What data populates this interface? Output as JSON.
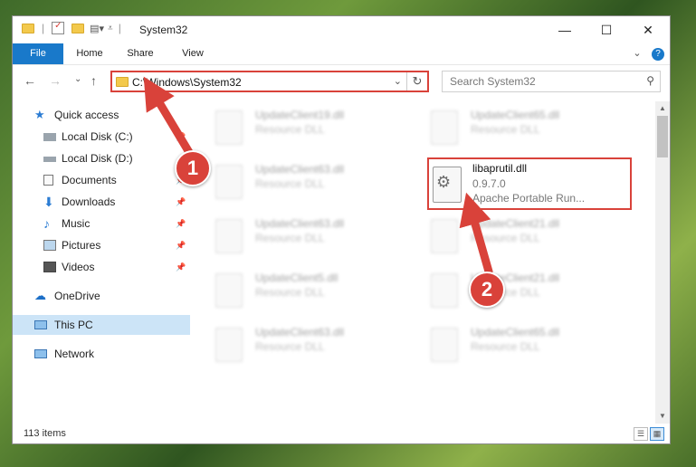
{
  "window": {
    "title": "System32",
    "minimize_glyph": "—",
    "maximize_glyph": "☐",
    "close_glyph": "✕"
  },
  "ribbon": {
    "tabs": [
      {
        "label": "File"
      },
      {
        "label": "Home"
      },
      {
        "label": "Share"
      },
      {
        "label": "View"
      }
    ],
    "expand_glyph": "⌄",
    "help_glyph": "?"
  },
  "address": {
    "path": "C:\\Windows\\System32",
    "back_glyph": "←",
    "forward_glyph": "→",
    "recent_glyph": "⌄",
    "up_glyph": "↑",
    "dropdown_glyph": "⌄",
    "refresh_glyph": "↻"
  },
  "search": {
    "placeholder": "Search System32",
    "icon": "search-icon"
  },
  "sidebar": {
    "items": [
      {
        "label": "Quick access",
        "icon": "star-icon",
        "pinned": false
      },
      {
        "label": "Local Disk (C:)",
        "icon": "drive-icon",
        "pinned": true
      },
      {
        "label": "Local Disk (D:)",
        "icon": "drive-icon",
        "pinned": false
      },
      {
        "label": "Documents",
        "icon": "documents-icon",
        "pinned": true
      },
      {
        "label": "Downloads",
        "icon": "download-icon",
        "pinned": true
      },
      {
        "label": "Music",
        "icon": "music-icon",
        "pinned": true
      },
      {
        "label": "Pictures",
        "icon": "pictures-icon",
        "pinned": true
      },
      {
        "label": "Videos",
        "icon": "videos-icon",
        "pinned": true
      },
      {
        "label": "OneDrive",
        "icon": "cloud-icon",
        "pinned": false
      },
      {
        "label": "This PC",
        "icon": "computer-icon",
        "pinned": false
      },
      {
        "label": "Network",
        "icon": "network-icon",
        "pinned": false
      }
    ],
    "pin_glyph": "📌"
  },
  "files": {
    "left_column": [
      {
        "name": "UpdateClient19.dll",
        "type": "Resource DLL"
      },
      {
        "name": "UpdateClient63.dll",
        "type": "Resource DLL"
      },
      {
        "name": "UpdateClient63.dll",
        "type": "Resource DLL"
      },
      {
        "name": "UpdateClient5.dll",
        "type": "Resource DLL"
      },
      {
        "name": "UpdateClient63.dll",
        "type": "Resource DLL"
      }
    ],
    "right_column": [
      {
        "name": "UpdateClient65.dll",
        "type": "Resource DLL"
      },
      {
        "name": "UpdateClient21.dll",
        "type": "Resource DLL"
      },
      {
        "name": "UpdateClient21.dll",
        "type": "Resource DLL"
      },
      {
        "name": "UpdateClient65.dll",
        "type": "Resource DLL"
      }
    ],
    "highlighted": {
      "name": "libaprutil.dll",
      "version": "0.9.7.0",
      "description": "Apache Portable Run..."
    }
  },
  "status": {
    "item_count": "113 items"
  },
  "annotations": {
    "step1": "1",
    "step2": "2",
    "color": "#d9423a"
  }
}
